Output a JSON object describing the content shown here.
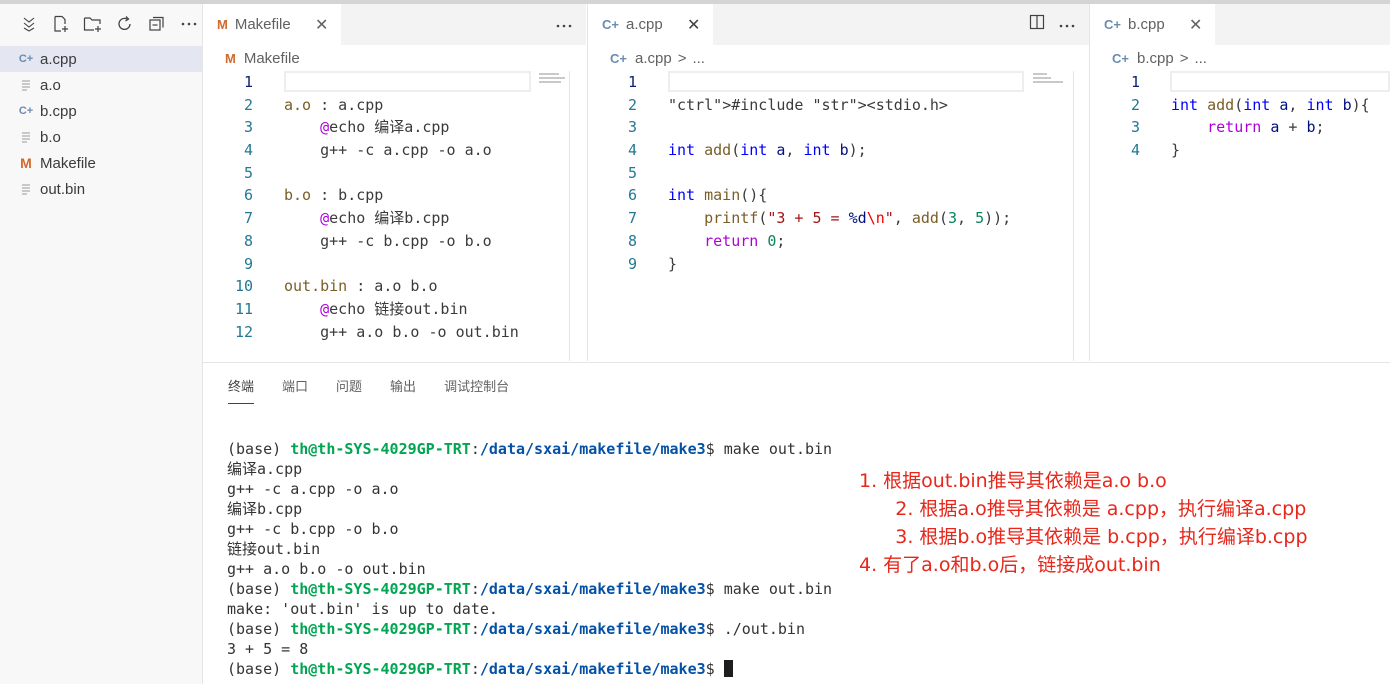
{
  "explorer": {
    "files": [
      {
        "name": "a.cpp",
        "icon": "cpp-icon",
        "active": true
      },
      {
        "name": "a.o",
        "icon": "text-file-icon",
        "active": false
      },
      {
        "name": "b.cpp",
        "icon": "cpp-icon",
        "active": false
      },
      {
        "name": "b.o",
        "icon": "text-file-icon",
        "active": false
      },
      {
        "name": "Makefile",
        "icon": "makefile-icon",
        "active": false
      },
      {
        "name": "out.bin",
        "icon": "text-file-icon",
        "active": false
      }
    ]
  },
  "editors": {
    "makefile": {
      "tab_label": "Makefile",
      "breadcrumb": "Makefile",
      "lines": [
        {
          "n": "1",
          "t": ""
        },
        {
          "n": "2",
          "t": "a.o : a.cpp"
        },
        {
          "n": "3",
          "t": "    @echo 编译a.cpp"
        },
        {
          "n": "4",
          "t": "    g++ -c a.cpp -o a.o"
        },
        {
          "n": "5",
          "t": ""
        },
        {
          "n": "6",
          "t": "b.o : b.cpp"
        },
        {
          "n": "7",
          "t": "    @echo 编译b.cpp"
        },
        {
          "n": "8",
          "t": "    g++ -c b.cpp -o b.o"
        },
        {
          "n": "9",
          "t": ""
        },
        {
          "n": "10",
          "t": "out.bin : a.o b.o"
        },
        {
          "n": "11",
          "t": "    @echo 链接out.bin"
        },
        {
          "n": "12",
          "t": "    g++ a.o b.o -o out.bin"
        }
      ]
    },
    "acpp": {
      "tab_label": "a.cpp",
      "breadcrumb_file": "a.cpp",
      "breadcrumb_sep": ">",
      "breadcrumb_rest": "...",
      "lines": [
        {
          "n": "1",
          "t": ""
        },
        {
          "n": "2",
          "t": "#include <stdio.h>"
        },
        {
          "n": "3",
          "t": ""
        },
        {
          "n": "4",
          "t": "int add(int a, int b);"
        },
        {
          "n": "5",
          "t": ""
        },
        {
          "n": "6",
          "t": "int main(){"
        },
        {
          "n": "7",
          "t": "    printf(\"3 + 5 = %d\\n\", add(3, 5));"
        },
        {
          "n": "8",
          "t": "    return 0;"
        },
        {
          "n": "9",
          "t": "}"
        }
      ]
    },
    "bcpp": {
      "tab_label": "b.cpp",
      "breadcrumb_file": "b.cpp",
      "breadcrumb_sep": ">",
      "breadcrumb_rest": "...",
      "lines": [
        {
          "n": "1",
          "t": ""
        },
        {
          "n": "2",
          "t": "int add(int a, int b){"
        },
        {
          "n": "3",
          "t": "    return a + b;"
        },
        {
          "n": "4",
          "t": "}"
        }
      ]
    }
  },
  "panel": {
    "tabs": [
      "终端",
      "端口",
      "问题",
      "输出",
      "调试控制台"
    ],
    "active_tab": "终端",
    "terminal": {
      "prompt_base": "(base) ",
      "prompt_user": "th@th-SYS-4029GP-TRT",
      "prompt_colon": ":",
      "prompt_path": "/data/sxai/makefile/make3",
      "prompt_end": "$ ",
      "lines": [
        {
          "type": "prompt",
          "cmd": "make out.bin"
        },
        {
          "type": "out",
          "text": "编译a.cpp"
        },
        {
          "type": "out",
          "text": "g++ -c a.cpp -o a.o"
        },
        {
          "type": "out",
          "text": "编译b.cpp"
        },
        {
          "type": "out",
          "text": "g++ -c b.cpp -o b.o"
        },
        {
          "type": "out",
          "text": "链接out.bin"
        },
        {
          "type": "out",
          "text": "g++ a.o b.o -o out.bin"
        },
        {
          "type": "prompt",
          "cmd": "make out.bin"
        },
        {
          "type": "out",
          "text": "make: 'out.bin' is up to date."
        },
        {
          "type": "prompt",
          "cmd": "./out.bin"
        },
        {
          "type": "out",
          "text": "3 + 5 = 8"
        },
        {
          "type": "prompt",
          "cmd": "",
          "cursor": true
        }
      ]
    }
  },
  "annotations": [
    "1. 根据out.bin推导其依赖是a.o b.o",
    "      2. 根据a.o推导其依赖是 a.cpp，执行编译a.cpp",
    "      3. 根据b.o推导其依赖是 b.cpp，执行编译b.cpp",
    "4. 有了a.o和b.o后，链接成out.bin"
  ],
  "colors": {
    "annotation": "#e8261a",
    "prompt_user": "#00a651",
    "prompt_path": "#0451a5",
    "makefile_icon": "#d06a2e",
    "cpp_icon": "#6a8caf"
  }
}
